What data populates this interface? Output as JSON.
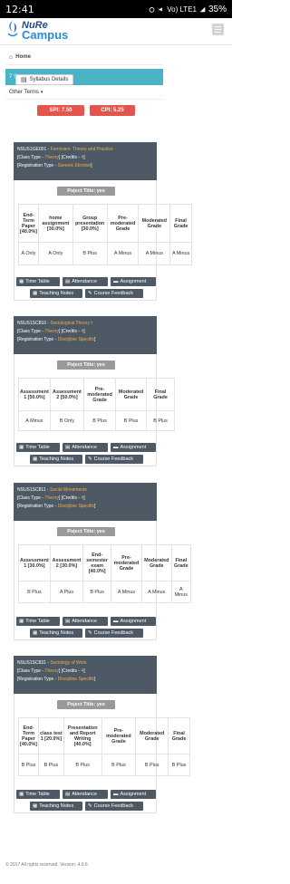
{
  "status": {
    "time": "12:41",
    "signal": "Vo) LTE1",
    "battery": "35%"
  },
  "header": {
    "logo_line1": "NuRe",
    "logo_line2": "Campus",
    "menu_icon": "hamburger-icon"
  },
  "breadcrumb": {
    "home": "Home"
  },
  "semester": {
    "label": "7 Semester"
  },
  "other_terms": {
    "label": "Other Terms"
  },
  "scores": {
    "spi": "SPI:  7.50",
    "cpi": "CPI:  5.25"
  },
  "syllabus": {
    "label": "Syllabus Details"
  },
  "courses": [
    {
      "code": "NSUS1GE001",
      "title": "Feminism: Theory and Practice",
      "class_type_label": "[Class Type - ",
      "class_type": "Theory",
      "credits_label": "] [Credits - ",
      "credits": "4",
      "close": "]",
      "reg_label": "[Registration Type - ",
      "reg_type": "Generic Elective",
      "project": "Poject Title:  yes",
      "headers": [
        "End-Term Paper [40.0%]",
        "home assignment [30.0%]",
        "Group presentation [30.0%]",
        "Pre-moderated Grade",
        "Moderated Grade",
        "Final Grade"
      ],
      "values": [
        "A Only",
        "A Only",
        "B Plus",
        "A Minus",
        "A Minus",
        "A Minus"
      ]
    },
    {
      "code": "NSUS1SC810",
      "title": "Sociological Theory I",
      "class_type_label": "[Class Type - ",
      "class_type": "Theory",
      "credits_label": "] [Credits - ",
      "credits": "4",
      "close": "]",
      "reg_label": "[Registration Type - ",
      "reg_type": "Discipline Specific",
      "project": "Poject Title:  yes",
      "headers": [
        "Assessment 1 [50.0%]",
        "Assessment 2 [50.0%]",
        "Pre-moderated Grade",
        "Moderated Grade",
        "Final Grade"
      ],
      "values": [
        "A Minus",
        "B Only",
        "B Plus",
        "B Plus",
        "B Plus"
      ]
    },
    {
      "code": "NSUS1SC811",
      "title": "Social Movements",
      "class_type_label": "[Class Type - ",
      "class_type": "Theory",
      "credits_label": "] [Credits - ",
      "credits": "4",
      "close": "]",
      "reg_label": "[Registration Type - ",
      "reg_type": "Discipline Specific",
      "project": "Poject Title:  yes",
      "headers": [
        "Assessment 1 [30.0%]",
        "Assessment 2 [30.0%]",
        "End-semester exam [40.0%]",
        "Pre-moderated Grade",
        "Moderated Grade",
        "Final Grade"
      ],
      "values": [
        "B Plus",
        "A Plus",
        "B Plus",
        "A Minus",
        "A Minus",
        "A Minus"
      ]
    },
    {
      "code": "NSUS1SC831",
      "title": "Sociology of Work",
      "class_type_label": "[Class Type - ",
      "class_type": "Theory",
      "credits_label": "] [Credits - ",
      "credits": "4",
      "close": "]",
      "reg_label": "[Registration Type - ",
      "reg_type": "Discipline Specific",
      "project": "Poject Title:  yes",
      "headers": [
        "End-Term Paper [40.0%]",
        "class test 1 [20.0%]",
        "Presentation and Report Writing [40.0%]",
        "Pre-moderated Grade",
        "Moderated Grade",
        "Final Grade"
      ],
      "values": [
        "B Plus",
        "B Plus",
        "B Plus",
        "B Plus",
        "B Plus",
        "B Plus"
      ]
    }
  ],
  "buttons": {
    "timetable": "Time Table",
    "attendance": "Attendance",
    "assignment": "Assignment",
    "teaching_notes": "Teaching Notes",
    "course_feedback": "Course Feedback"
  },
  "footer": {
    "text": "© 2017 All rights reserved. Version: 4.0.6"
  },
  "colors": {
    "accent": "#4ab3c6",
    "score": "#e4554e",
    "panel": "#4d5965",
    "highlight": "#f0ad4e"
  }
}
